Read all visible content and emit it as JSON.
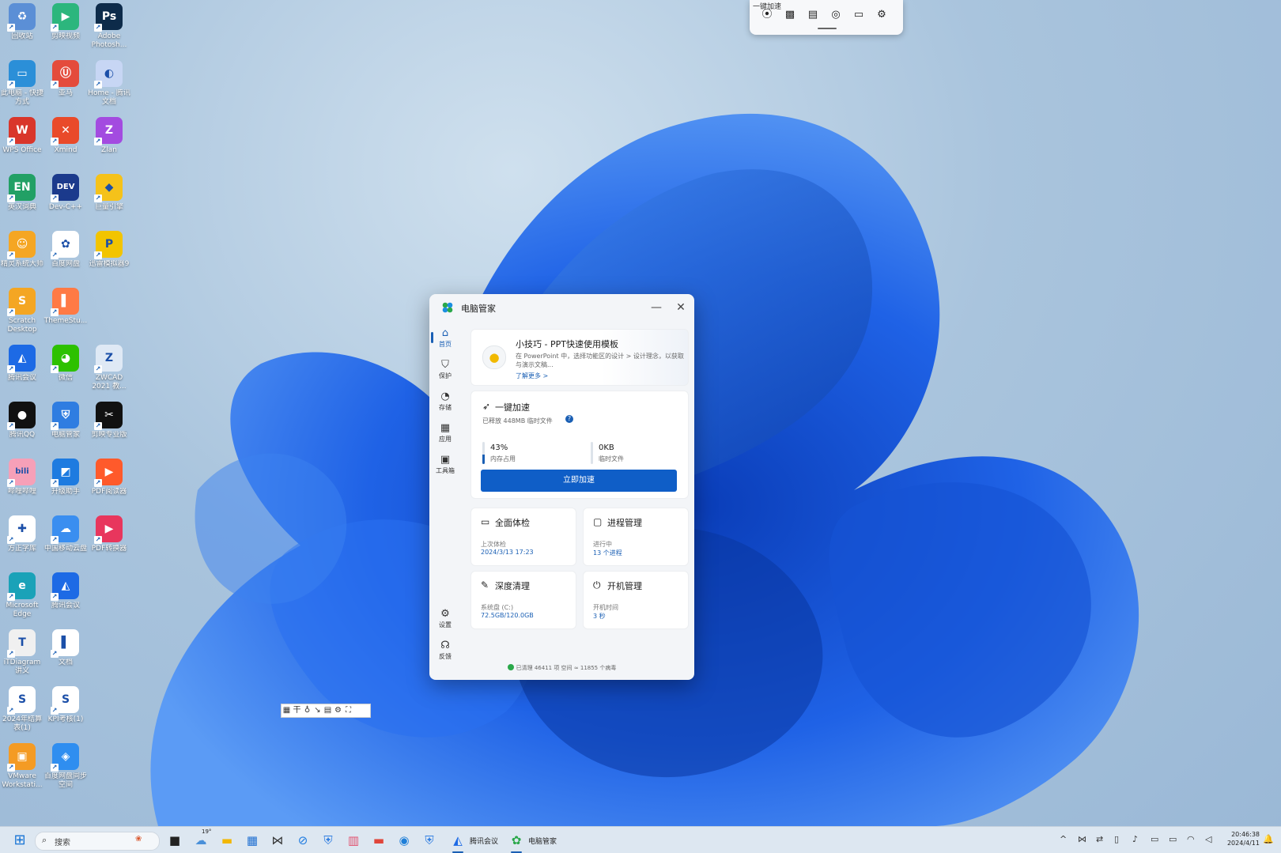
{
  "desktop": {
    "icons": [
      {
        "label": "回收站",
        "glyph": "♻",
        "color": "#5b8fd6"
      },
      {
        "label": "剪映视频",
        "glyph": "▶",
        "color": "#2cb67d"
      },
      {
        "label": "Adobe Photosh...",
        "glyph": "Ps",
        "color": "#0d2b4a"
      },
      {
        "label": "此电脑 - 快捷方式",
        "glyph": "▭",
        "color": "#2b8fd8"
      },
      {
        "label": "亚马",
        "glyph": "Ⓤ",
        "color": "#e44b3c"
      },
      {
        "label": "Home - 腾讯文档",
        "glyph": "◐",
        "color": "#c7d6f4"
      },
      {
        "label": "WPS Office",
        "glyph": "W",
        "color": "#d9362b"
      },
      {
        "label": "Xmind",
        "glyph": "✕",
        "color": "#e94a2a"
      },
      {
        "label": "Zlan",
        "glyph": "Z",
        "color": "#a34be0"
      },
      {
        "label": "英汉词典",
        "glyph": "EN",
        "color": "#22a065"
      },
      {
        "label": "Dev-C++",
        "glyph": "DEV",
        "color": "#1b3a8c"
      },
      {
        "label": "巨量引擎",
        "glyph": "◆",
        "color": "#f5c21a"
      },
      {
        "label": "精灵系统大师",
        "glyph": "☺",
        "color": "#f5a623"
      },
      {
        "label": "百度网盘",
        "glyph": "✿",
        "color": "#ffffff"
      },
      {
        "label": "迅雷模拟器9",
        "glyph": "P",
        "color": "#f2c400"
      },
      {
        "label": "Scratch Desktop",
        "glyph": "S",
        "color": "#f4a623"
      },
      {
        "label": "ThemeStu...",
        "glyph": "▌",
        "color": "#ff7a45"
      },
      {
        "label": "",
        "glyph": "",
        "color": "transparent"
      },
      {
        "label": "腾讯会议",
        "glyph": "◭",
        "color": "#1d6ae5"
      },
      {
        "label": "微信",
        "glyph": "◕",
        "color": "#2dc100"
      },
      {
        "label": "ZWCAD 2021 教...",
        "glyph": "Z",
        "color": "#dfe9f5"
      },
      {
        "label": "腾讯QQ",
        "glyph": "●",
        "color": "#111111"
      },
      {
        "label": "电脑管家",
        "glyph": "⛨",
        "color": "#2f7de1"
      },
      {
        "label": "剪映专业版",
        "glyph": "✂",
        "color": "#111111"
      },
      {
        "label": "哔哩哔哩",
        "glyph": "bili",
        "color": "#f6a0b8"
      },
      {
        "label": "升级助手",
        "glyph": "◩",
        "color": "#1e7be0"
      },
      {
        "label": "PDF阅读器",
        "glyph": "▶",
        "color": "#ff5a2b"
      },
      {
        "label": "方正字库",
        "glyph": "✚",
        "color": "#ffffff"
      },
      {
        "label": "中国移动云盘",
        "glyph": "☁",
        "color": "#3a8ef0"
      },
      {
        "label": "PDF转换器",
        "glyph": "▶",
        "color": "#e8365d"
      },
      {
        "label": "Microsoft Edge",
        "glyph": "e",
        "color": "#1aa2b8"
      },
      {
        "label": "腾讯会议",
        "glyph": "◭",
        "color": "#1d6ae5"
      },
      {
        "label": "",
        "glyph": "",
        "color": "transparent"
      },
      {
        "label": "iTDiagram 讲义",
        "glyph": "T",
        "color": "#f0f0f0"
      },
      {
        "label": "文档",
        "glyph": "▌",
        "color": "#ffffff"
      },
      {
        "label": "",
        "glyph": "",
        "color": "transparent"
      },
      {
        "label": "2024年结算表(1)",
        "glyph": "S",
        "color": "#ffffff"
      },
      {
        "label": "KPI考核(1)",
        "glyph": "S",
        "color": "#ffffff"
      },
      {
        "label": "",
        "glyph": "",
        "color": "transparent"
      },
      {
        "label": "VMware Workstati...",
        "glyph": "▣",
        "color": "#f49b24"
      },
      {
        "label": "百度网盘同步空间",
        "glyph": "◈",
        "color": "#2f8ef0"
      },
      {
        "label": "",
        "glyph": "",
        "color": "transparent"
      }
    ]
  },
  "quickbar": {
    "tooltip": "一键加速",
    "items": [
      {
        "name": "rocket-icon",
        "glyph": "⦿"
      },
      {
        "name": "chip-icon",
        "glyph": "▩"
      },
      {
        "name": "document-icon",
        "glyph": "▤"
      },
      {
        "name": "edge-icon",
        "glyph": "◎"
      },
      {
        "name": "folder-icon",
        "glyph": "▭"
      },
      {
        "name": "settings-icon",
        "glyph": "⚙"
      }
    ]
  },
  "window": {
    "title": "电脑管家",
    "min": "—",
    "close": "✕",
    "nav": [
      {
        "label": "首页",
        "icon": "⌂",
        "active": true
      },
      {
        "label": "保护",
        "icon": "⛉",
        "active": false
      },
      {
        "label": "存储",
        "icon": "◔",
        "active": false
      },
      {
        "label": "应用",
        "icon": "▦",
        "active": false
      },
      {
        "label": "工具箱",
        "icon": "▣",
        "active": false
      },
      {
        "label": "设置",
        "icon": "⚙",
        "active": false
      },
      {
        "label": "反馈",
        "icon": "☊",
        "active": false
      }
    ],
    "tip": {
      "title": "小技巧 - PPT快速使用模板",
      "text": "在 PowerPoint 中，选择功能区的设计 > 设计理念，以获取与演示文稿...",
      "link": "了解更多 >"
    },
    "speed": {
      "title": "一键加速",
      "subtitle": "已释放 448MB 临时文件",
      "memory_value": "43%",
      "memory_percent": 43,
      "memory_caption": "内存占用",
      "temp_value": "0KB",
      "temp_percent": 0,
      "temp_caption": "临时文件",
      "button": "立即加速"
    },
    "tiles": [
      {
        "title": "全面体检",
        "icon": "▭",
        "label": "上次体检",
        "value": "2024/3/13 17:23"
      },
      {
        "title": "进程管理",
        "icon": "▢",
        "label": "进行中",
        "value": "13 个进程"
      },
      {
        "title": "深度清理",
        "icon": "✎",
        "label": "系统盘 (C:)",
        "value": "72.5GB/120.0GB"
      },
      {
        "title": "开机管理",
        "icon": "⏻",
        "label": "开机时间",
        "value": "3 秒"
      }
    ],
    "status": "已清理 46411 项 空间 ≈ 11855 个病毒"
  },
  "floating_toolbar": [
    "▦",
    "干",
    "♁",
    "↘",
    "▤",
    "⚙",
    "⛶"
  ],
  "taskbar": {
    "search_placeholder": "搜索",
    "weather": "19°",
    "apps": [
      {
        "name": "taskview-icon",
        "glyph": "■",
        "color": "#222222"
      },
      {
        "name": "weather-icon",
        "glyph": "☁",
        "color": "#4a90d9"
      },
      {
        "name": "file-explorer-icon",
        "glyph": "▬",
        "color": "#f2b705"
      },
      {
        "name": "store-icon",
        "glyph": "▦",
        "color": "#1f6fd1"
      },
      {
        "name": "app-icon",
        "glyph": "⋈",
        "color": "#333333"
      },
      {
        "name": "app-icon",
        "glyph": "⊘",
        "color": "#1e7be0"
      },
      {
        "name": "guard-icon",
        "glyph": "⛨",
        "color": "#2f7de1"
      },
      {
        "name": "app-icon",
        "glyph": "▥",
        "color": "#e2506e"
      },
      {
        "name": "app-icon",
        "glyph": "▬",
        "color": "#e0453a"
      },
      {
        "name": "edge-icon",
        "glyph": "◉",
        "color": "#1f7fd8"
      },
      {
        "name": "guard-icon",
        "glyph": "⛨",
        "color": "#2f7de1"
      }
    ],
    "running": [
      {
        "label": "腾讯会议",
        "glyph": "◭",
        "color": "#1d6ae5"
      },
      {
        "label": "电脑管家",
        "glyph": "✿",
        "color": "#2aa84a"
      }
    ],
    "tray": [
      "^",
      "⋈",
      "⇄",
      "▯",
      "♪",
      "▭",
      "▭",
      "◠",
      "◁"
    ],
    "time": "20:46:38",
    "date": "2024/4/11"
  }
}
